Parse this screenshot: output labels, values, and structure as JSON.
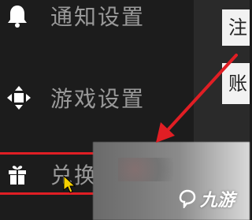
{
  "menu": {
    "items": [
      {
        "label": "通知设置",
        "icon": "bell-icon"
      },
      {
        "label": "游戏设置",
        "icon": "gamepad-icon"
      },
      {
        "label": "兑换",
        "icon": "gift-icon"
      }
    ]
  },
  "right_panel": {
    "card_text_1": "注",
    "card_text_2": "账"
  },
  "watermark": {
    "text": "九游"
  },
  "colors": {
    "highlight": "#e01e24",
    "label": "#9a9a9a",
    "background": "#1c1c1c"
  }
}
